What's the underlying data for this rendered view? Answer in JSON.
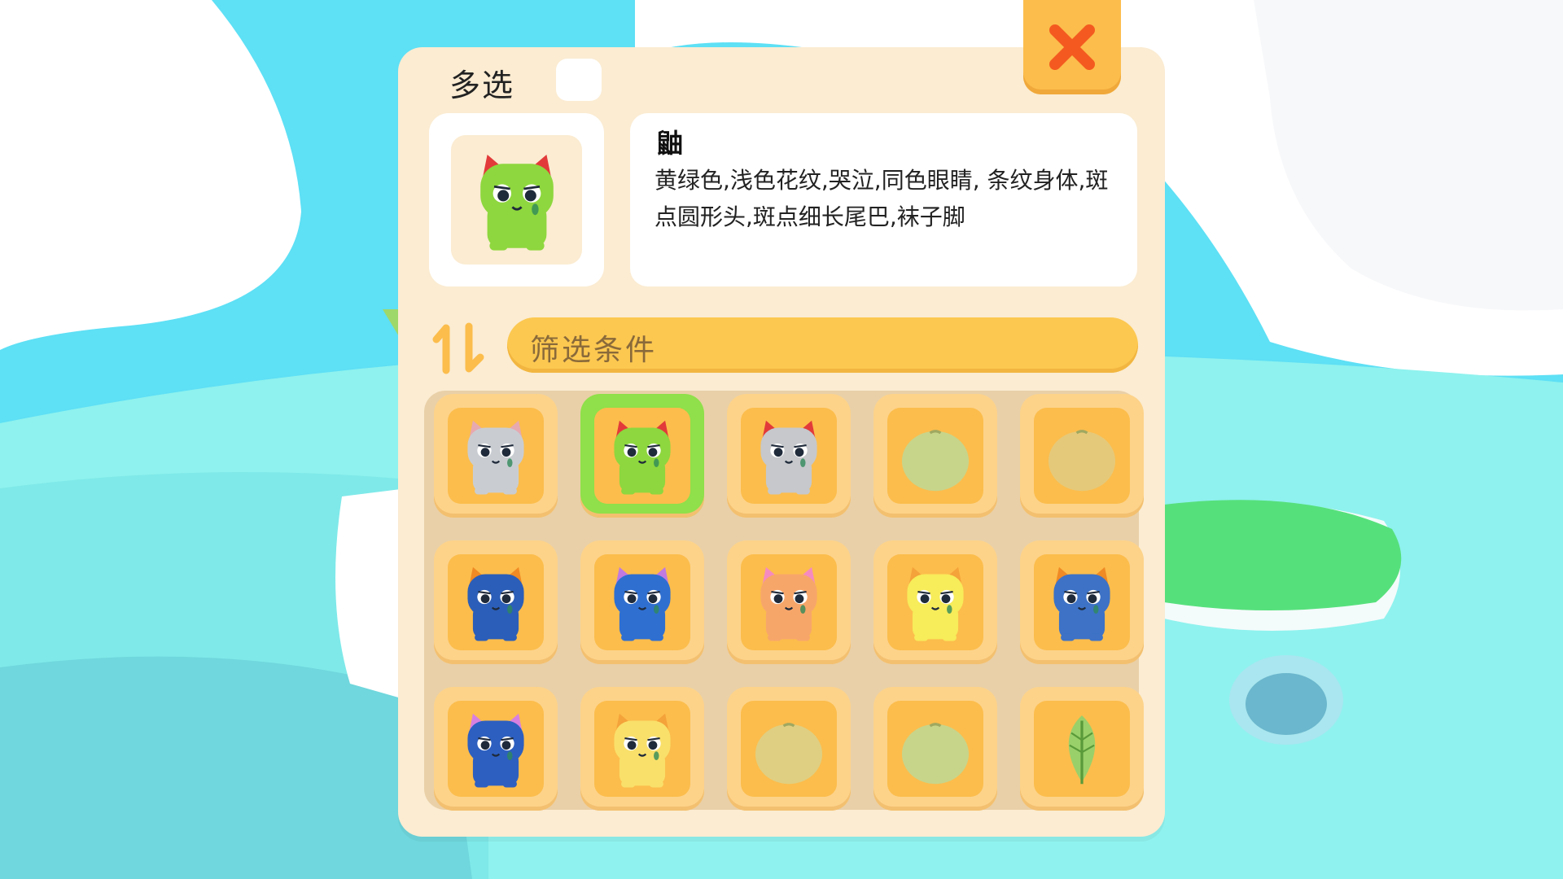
{
  "header": {
    "title": "多选"
  },
  "detail": {
    "name": "鼬",
    "description": "黄绿色,浅色花纹,哭泣,同色眼睛, 条纹身体,斑点圆形头,斑点细长尾巴,袜子脚"
  },
  "filter": {
    "label": "筛选条件"
  },
  "colors": {
    "panel": "#fbecd2",
    "accent": "#fcc850",
    "close": "#fcbd4c",
    "close_x": "#f45a1f",
    "selected": "#8fe04a"
  },
  "icons": {
    "close": "close-icon",
    "sort": "sort-icon"
  },
  "preview": {
    "kind": "cat",
    "body": "#8ed73e",
    "ear": "#e23a3a",
    "eye": "crying"
  },
  "slots": [
    {
      "kind": "cat",
      "body": "#c9cdd2",
      "ear": "#e6a9b0",
      "selected": false
    },
    {
      "kind": "cat",
      "body": "#8ed73e",
      "ear": "#e23a3a",
      "selected": true
    },
    {
      "kind": "cat",
      "body": "#c6c8cb",
      "ear": "#e23a3a",
      "selected": false
    },
    {
      "kind": "egg",
      "body": "#c7d58a",
      "selected": false
    },
    {
      "kind": "egg",
      "body": "#e5c97a",
      "selected": false
    },
    {
      "kind": "cat",
      "body": "#2b5eb8",
      "ear": "#ef8a24",
      "selected": false
    },
    {
      "kind": "cat",
      "body": "#2f6fd0",
      "ear": "#c07ae0",
      "selected": false
    },
    {
      "kind": "cat",
      "body": "#f7a66a",
      "ear": "#f58ac0",
      "selected": false
    },
    {
      "kind": "cat",
      "body": "#f7ec5a",
      "ear": "#f4a23a",
      "selected": false
    },
    {
      "kind": "cat",
      "body": "#3d72c6",
      "ear": "#ef8a24",
      "selected": false
    },
    {
      "kind": "cat",
      "body": "#2d5fc0",
      "ear": "#d880e0",
      "selected": false
    },
    {
      "kind": "cat",
      "body": "#f9e06a",
      "ear": "#f4a23a",
      "selected": false
    },
    {
      "kind": "egg",
      "body": "#dfcf82",
      "selected": false
    },
    {
      "kind": "egg",
      "body": "#c7d58a",
      "selected": false
    },
    {
      "kind": "leaf",
      "body": "#9ad06a",
      "selected": false
    }
  ]
}
